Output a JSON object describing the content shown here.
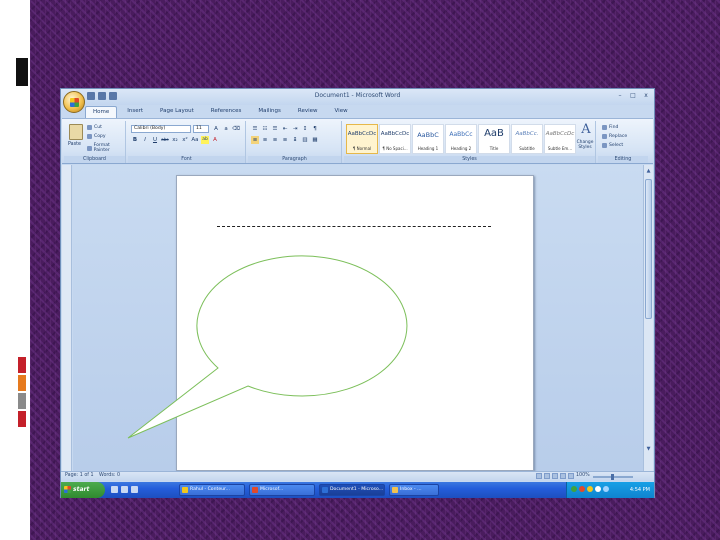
{
  "word": {
    "title": "Document1 - Microsoft Word",
    "tabs": [
      "Home",
      "Insert",
      "Page Layout",
      "References",
      "Mailings",
      "Review",
      "View"
    ],
    "window_controls": [
      "–",
      "□",
      "x"
    ],
    "clipboard": {
      "paste": "Paste",
      "cut": "Cut",
      "copy": "Copy",
      "format_painter": "Format Painter",
      "label": "Clipboard"
    },
    "font": {
      "name": "Calibri (Body)",
      "size": "11",
      "format_buttons": [
        "B",
        "I",
        "U",
        "abe",
        "x₂",
        "x²",
        "Aa",
        "ab",
        "A"
      ],
      "label": "Font"
    },
    "paragraph": {
      "label": "Paragraph"
    },
    "styles": {
      "tiles": [
        {
          "sample": "AaBbCcDc",
          "name": "¶ Normal"
        },
        {
          "sample": "AaBbCcDc",
          "name": "¶ No Spaci..."
        },
        {
          "sample": "AaBbC",
          "name": "Heading 1"
        },
        {
          "sample": "AaBbCc",
          "name": "Heading 2"
        },
        {
          "sample": "AaB",
          "name": "Title"
        },
        {
          "sample": "AaBbCc.",
          "name": "Subtitle"
        },
        {
          "sample": "AaBbCcDc",
          "name": "Subtle Em..."
        }
      ],
      "change_styles": "Change Styles",
      "label": "Styles"
    },
    "editing": {
      "find": "Find",
      "replace": "Replace",
      "select": "Select",
      "label": "Editing"
    },
    "status": {
      "page": "Page: 1 of 1",
      "words": "Words: 0",
      "zoom": "100%"
    }
  },
  "taskbar": {
    "start": "start",
    "tasks": [
      {
        "label": "Rahul - Conteur..."
      },
      {
        "label": "Microsof..."
      },
      {
        "label": "Document1 - Microso..."
      },
      {
        "label": "Inbox - ..."
      }
    ],
    "clock": "4:54 PM"
  },
  "colors": {
    "purple_background": "#4a1c5e",
    "callout_outline": "#7cbf5a",
    "ribbon_blue": "#c5d7ef",
    "taskbar_blue": "#245edb",
    "deco_red": "#c4202a",
    "deco_orange": "#e67a1e",
    "deco_gray": "#8a8a8a"
  }
}
